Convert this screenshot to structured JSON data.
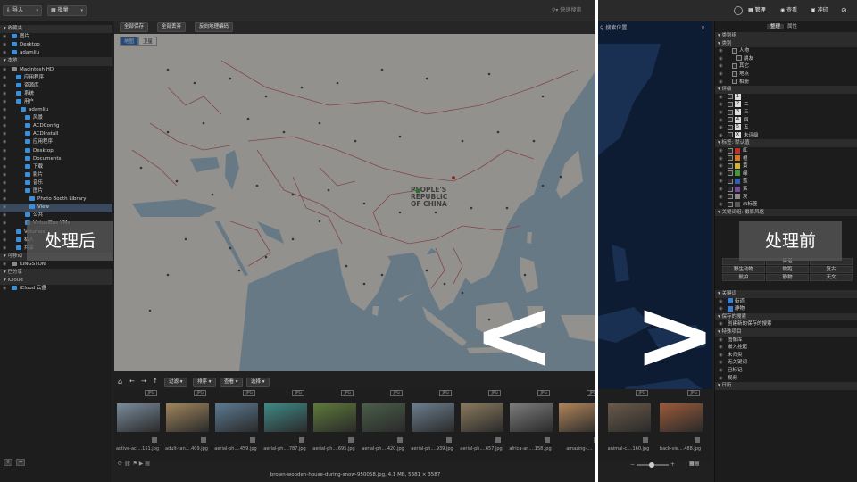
{
  "topbar": {
    "import_label": "导入",
    "batch_label": "批量",
    "search_placeholder": "快速搜索",
    "right_search_placeholder": "搜索位置",
    "manage_label": "管理",
    "view_label": "查看",
    "develop_label": "冲印"
  },
  "sidebar": {
    "rows": [
      {
        "label": "收藏夹",
        "type": "sec",
        "indent": 0
      },
      {
        "label": "图片",
        "type": "folder",
        "indent": 1
      },
      {
        "label": "Desktop",
        "type": "folder",
        "indent": 1
      },
      {
        "label": "adamliu",
        "type": "folder",
        "indent": 1
      },
      {
        "label": "本地",
        "type": "sec",
        "indent": 0
      },
      {
        "label": "Macintosh HD",
        "type": "hd",
        "indent": 1
      },
      {
        "label": "应用程序",
        "type": "folder",
        "indent": 2
      },
      {
        "label": "资源库",
        "type": "folder",
        "indent": 2
      },
      {
        "label": "系统",
        "type": "folder",
        "indent": 2
      },
      {
        "label": "用户",
        "type": "folder",
        "indent": 2
      },
      {
        "label": "adamliu",
        "type": "folder",
        "indent": 3
      },
      {
        "label": "风景",
        "type": "folder",
        "indent": 4
      },
      {
        "label": "ACDConfig",
        "type": "folder",
        "indent": 4
      },
      {
        "label": "ACDInstall",
        "type": "folder",
        "indent": 4
      },
      {
        "label": "应用程序",
        "type": "folder",
        "indent": 4
      },
      {
        "label": "Desktop",
        "type": "folder",
        "indent": 4
      },
      {
        "label": "Documents",
        "type": "folder",
        "indent": 4
      },
      {
        "label": "下载",
        "type": "folder",
        "indent": 4
      },
      {
        "label": "影片",
        "type": "folder",
        "indent": 4
      },
      {
        "label": "音乐",
        "type": "folder",
        "indent": 4
      },
      {
        "label": "图片",
        "type": "folder",
        "indent": 4
      },
      {
        "label": "Photo Booth Library",
        "type": "folder",
        "indent": 5
      },
      {
        "label": "View",
        "type": "sel",
        "indent": 5
      },
      {
        "label": "公共",
        "type": "folder",
        "indent": 4
      },
      {
        "label": "VirtualBox VMs",
        "type": "folder",
        "indent": 4
      },
      {
        "label": "Volumes",
        "type": "folder",
        "indent": 2
      },
      {
        "label": "私人",
        "type": "folder",
        "indent": 2
      },
      {
        "label": "共享",
        "type": "folder",
        "indent": 2
      },
      {
        "label": "可移动",
        "type": "sec",
        "indent": 0
      },
      {
        "label": "KINGSTON",
        "type": "hd",
        "indent": 1
      },
      {
        "label": "已分享",
        "type": "sec",
        "indent": 0
      },
      {
        "label": "iCloud",
        "type": "sec",
        "indent": 0
      },
      {
        "label": "iCloud 云盘",
        "type": "folder",
        "indent": 1
      }
    ]
  },
  "map_toolbar": {
    "save_all": "全部保存",
    "discard_all": "全部丢弃",
    "reverse_geocode": "反向地理编码"
  },
  "map": {
    "tab_map": "地图",
    "tab_satellite": "卫星",
    "label_china": "PEOPLE'S REPUBLIC OF CHINA",
    "label_china_l1": "PEOPLE'S",
    "label_china_l2": "REPUBLIC",
    "label_china_l3": "OF CHINA"
  },
  "film_toolbar": {
    "filter": "过滤",
    "sort": "排序",
    "view": "查看",
    "select": "选择"
  },
  "thumbnails": [
    {
      "name": "active-ac....151.jpg",
      "tag": "JPG",
      "color": "#7a8c9c"
    },
    {
      "name": "adult-tan....409.jpg",
      "tag": "JPG",
      "color": "#a0855c"
    },
    {
      "name": "aerial-ph....459.jpg",
      "tag": "JPG",
      "color": "#5c7a92"
    },
    {
      "name": "aerial-ph....787.jpg",
      "tag": "JPG",
      "color": "#3f8a86"
    },
    {
      "name": "aerial-ph....695.jpg",
      "tag": "JPG",
      "color": "#5e7a3a"
    },
    {
      "name": "aerial-ph....420.jpg",
      "tag": "JPG",
      "color": "#4a5e4a"
    },
    {
      "name": "aerial-ph....939.jpg",
      "tag": "JPG",
      "color": "#6c7e8e"
    },
    {
      "name": "aerial-ph....657.jpg",
      "tag": "JPG",
      "color": "#8a7a5e"
    },
    {
      "name": "africa-an....158.jpg",
      "tag": "JPG",
      "color": "#7c7c7c"
    },
    {
      "name": "amazing-....",
      "tag": "JPG",
      "color": "#b0845a"
    }
  ],
  "right_thumbnails": [
    {
      "name": "animal-c....160.jpg",
      "tag": "JPG",
      "color": "#6a5a4a"
    },
    {
      "name": "back-vie....488.jpg",
      "tag": "JPG",
      "color": "#9a5a3a"
    }
  ],
  "status": "brown-wooden-house-during-snow-950058.jpg, 4.1 MB, 5381 × 3587",
  "right_panel": {
    "tab_manage": "整理",
    "tab_properties": "属性",
    "rows": [
      {
        "label": "类别组",
        "type": "sec"
      },
      {
        "label": "类别",
        "type": "sec"
      },
      {
        "label": "人物",
        "type": "cat",
        "indent": 1
      },
      {
        "label": "朋友",
        "type": "cat",
        "indent": 2
      },
      {
        "label": "其它",
        "type": "cat",
        "indent": 1
      },
      {
        "label": "地点",
        "type": "cat",
        "indent": 1
      },
      {
        "label": "相册",
        "type": "cat",
        "indent": 1
      },
      {
        "label": "评级",
        "type": "sec"
      },
      {
        "label": "一",
        "type": "rate",
        "num": "1"
      },
      {
        "label": "二",
        "type": "rate",
        "num": "2"
      },
      {
        "label": "三",
        "type": "rate",
        "num": "3"
      },
      {
        "label": "四",
        "type": "rate",
        "num": "4"
      },
      {
        "label": "五",
        "type": "rate",
        "num": "5"
      },
      {
        "label": "未评级",
        "type": "rate",
        "num": "X"
      },
      {
        "label": "标签: 默认值",
        "type": "sec"
      },
      {
        "label": "红",
        "type": "color",
        "swatch": "#c0302a"
      },
      {
        "label": "橙",
        "type": "color",
        "swatch": "#d57a20"
      },
      {
        "label": "黄",
        "type": "color",
        "swatch": "#d1b32a"
      },
      {
        "label": "绿",
        "type": "color",
        "swatch": "#3f9a3a"
      },
      {
        "label": "蓝",
        "type": "color",
        "swatch": "#3460b0"
      },
      {
        "label": "紫",
        "type": "color",
        "swatch": "#7a4aa0"
      },
      {
        "label": "灰",
        "type": "color",
        "swatch": "#8a8a8a"
      },
      {
        "label": "未标签",
        "type": "color",
        "swatch": "#5a5a5a"
      },
      {
        "label": "关键词组: 摄影风格",
        "type": "sec"
      }
    ],
    "kw_grid": [
      "",
      "街道",
      "",
      "野生动物",
      "微距",
      "复古",
      "航拍",
      "静物",
      "天文"
    ],
    "rows2": [
      {
        "label": "关键词",
        "type": "sec"
      },
      {
        "label": "街道",
        "type": "kw",
        "checked": true
      },
      {
        "label": "静物",
        "type": "kw",
        "checked": true
      },
      {
        "label": "保存的搜索",
        "type": "sec"
      },
      {
        "label": "创建新的保存的搜索",
        "type": "item"
      },
      {
        "label": "特殊项目",
        "type": "sec"
      },
      {
        "label": "图像库",
        "type": "item"
      },
      {
        "label": "嵌入挂起",
        "type": "item"
      },
      {
        "label": "未归类",
        "type": "item"
      },
      {
        "label": "无关键词",
        "type": "item"
      },
      {
        "label": "已标记",
        "type": "item"
      },
      {
        "label": "视频",
        "type": "item"
      },
      {
        "label": "日历",
        "type": "sec"
      }
    ]
  },
  "labels": {
    "after": "处理后",
    "before": "处理前",
    "left_arrow": "<",
    "right_arrow": ">"
  }
}
